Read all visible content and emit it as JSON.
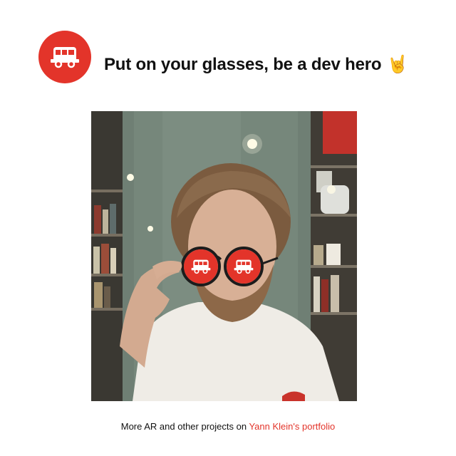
{
  "header": {
    "title": "Put on your glasses, be a dev hero",
    "emoji": "🤘",
    "logo_icon": "bus-icon"
  },
  "photo": {
    "lens_icon": "bus-icon"
  },
  "footer": {
    "text": "More AR and other projects on",
    "link_label": "Yann Klein's portfolio"
  },
  "colors": {
    "accent": "#e3342a",
    "text": "#111111",
    "background": "#ffffff"
  }
}
